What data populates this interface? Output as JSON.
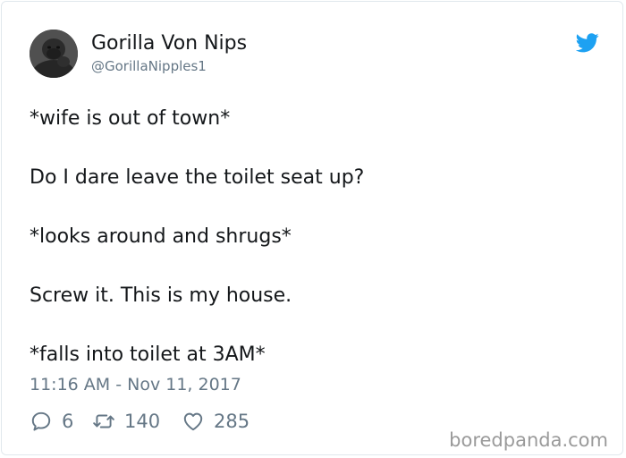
{
  "author": {
    "name": "Gorilla Von Nips",
    "handle": "@GorillaNipples1"
  },
  "tweet": {
    "lines": [
      "*wife is out of town*",
      "Do I dare leave the toilet seat up?",
      "*looks around and shrugs*",
      "Screw it. This is my house.",
      "*falls into toilet at 3AM*"
    ],
    "timestamp": "11:16 AM - Nov 11, 2017"
  },
  "actions": {
    "replies": "6",
    "retweets": "140",
    "likes": "285"
  },
  "watermark": "boredpanda.com",
  "colors": {
    "twitter_blue": "#1da1f2",
    "text": "#14171a",
    "muted": "#657786",
    "watermark": "#9a9a9a"
  }
}
